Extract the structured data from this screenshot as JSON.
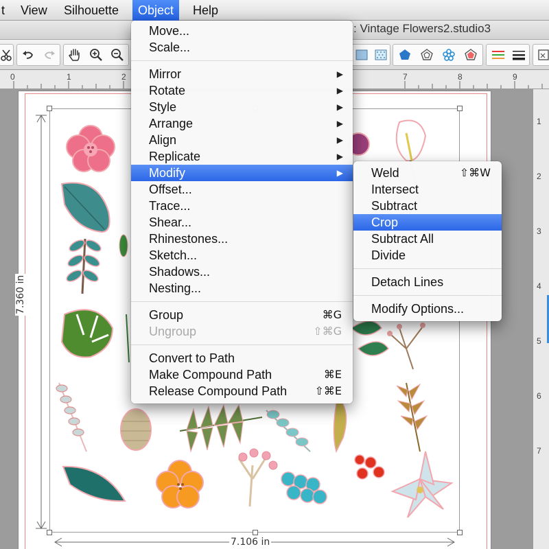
{
  "menubar": {
    "items": [
      "t",
      "View",
      "Silhouette",
      "Object",
      "Help"
    ],
    "active_index": 3
  },
  "window": {
    "title": ": Vintage Flowers2.studio3"
  },
  "rulers": {
    "horizontal_ticks": [
      "0",
      "1",
      "2",
      "7",
      "8",
      "9"
    ],
    "vertical_ticks": [
      "1",
      "2",
      "3",
      "4",
      "5",
      "6",
      "7"
    ]
  },
  "dimensions": {
    "height_label": "7.360 in",
    "width_label": "7.106 in"
  },
  "object_menu": {
    "items": [
      {
        "label": "Move...",
        "type": "item"
      },
      {
        "label": "Scale...",
        "type": "item"
      },
      {
        "type": "separator"
      },
      {
        "label": "Mirror",
        "type": "submenu"
      },
      {
        "label": "Rotate",
        "type": "submenu"
      },
      {
        "label": "Style",
        "type": "submenu"
      },
      {
        "label": "Arrange",
        "type": "submenu"
      },
      {
        "label": "Align",
        "type": "submenu"
      },
      {
        "label": "Replicate",
        "type": "submenu"
      },
      {
        "label": "Modify",
        "type": "submenu",
        "highlighted": true
      },
      {
        "label": "Offset...",
        "type": "item"
      },
      {
        "label": "Trace...",
        "type": "item"
      },
      {
        "label": "Shear...",
        "type": "item"
      },
      {
        "label": "Rhinestones...",
        "type": "item"
      },
      {
        "label": "Sketch...",
        "type": "item"
      },
      {
        "label": "Shadows...",
        "type": "item"
      },
      {
        "label": "Nesting...",
        "type": "item"
      },
      {
        "type": "separator"
      },
      {
        "label": "Group",
        "shortcut": "⌘G",
        "type": "item"
      },
      {
        "label": "Ungroup",
        "shortcut": "⇧⌘G",
        "type": "item",
        "disabled": true
      },
      {
        "type": "separator"
      },
      {
        "label": "Convert to Path",
        "type": "item"
      },
      {
        "label": "Make Compound Path",
        "shortcut": "⌘E",
        "type": "item"
      },
      {
        "label": "Release Compound Path",
        "shortcut": "⇧⌘E",
        "type": "item"
      }
    ]
  },
  "modify_submenu": {
    "items": [
      {
        "label": "Weld",
        "shortcut": "⇧⌘W",
        "type": "item"
      },
      {
        "label": "Intersect",
        "type": "item"
      },
      {
        "label": "Subtract",
        "type": "item"
      },
      {
        "label": "Crop",
        "type": "item",
        "highlighted": true
      },
      {
        "label": "Subtract All",
        "type": "item"
      },
      {
        "label": "Divide",
        "type": "item"
      },
      {
        "type": "separator"
      },
      {
        "label": "Detach Lines",
        "type": "item"
      },
      {
        "type": "separator"
      },
      {
        "label": "Modify Options...",
        "type": "item"
      }
    ]
  },
  "toolbar": {
    "left_icons": [
      "scissors-icon",
      "undo-icon",
      "redo-icon",
      "pan-hand-icon",
      "zoom-in-icon",
      "zoom-out-icon"
    ],
    "right_icons": [
      "fill-panel-icon",
      "pattern-fill-icon",
      "pentagon-icon",
      "rhinestone-icon",
      "flower-shape-icon",
      "offset-shape-icon",
      "line-color-icon",
      "line-style-icon",
      "window-icon"
    ]
  },
  "colors": {
    "menu_highlight": "#2c67e8",
    "cut_line": "#e38a8a"
  }
}
